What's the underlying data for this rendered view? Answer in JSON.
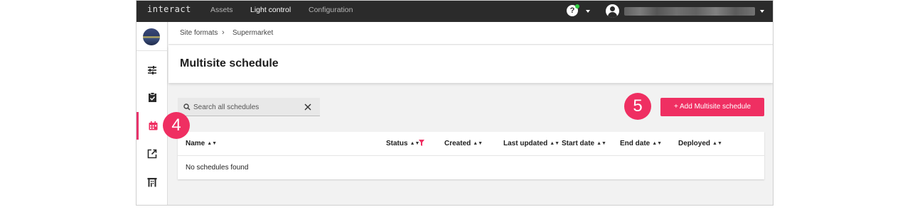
{
  "topbar": {
    "brand": "interact",
    "nav": [
      "Assets",
      "Light control",
      "Configuration"
    ],
    "active_nav": "Light control",
    "help_icon": "help-circle-icon",
    "user_icon": "account-circle-icon"
  },
  "sidebar": {
    "items": [
      {
        "icon": "sliders-icon"
      },
      {
        "icon": "clipboard-check-icon"
      },
      {
        "icon": "calendar-icon",
        "active": true
      },
      {
        "icon": "external-link-icon"
      },
      {
        "icon": "building-icon"
      }
    ]
  },
  "breadcrumb": [
    "Site formats",
    "Supermarket"
  ],
  "page": {
    "title": "Multisite schedule"
  },
  "search": {
    "placeholder": "Search all schedules",
    "value": ""
  },
  "add_button": "+ Add Multisite schedule",
  "table": {
    "columns": [
      "Name",
      "Status",
      "Created",
      "Last updated",
      "Start date",
      "End date",
      "Deployed"
    ],
    "empty_text": "No schedules found"
  },
  "callouts": [
    "4",
    "5"
  ],
  "colors": {
    "accent": "#ef2f62",
    "topbar": "#2b2b2b",
    "background": "#f2f2f2"
  }
}
